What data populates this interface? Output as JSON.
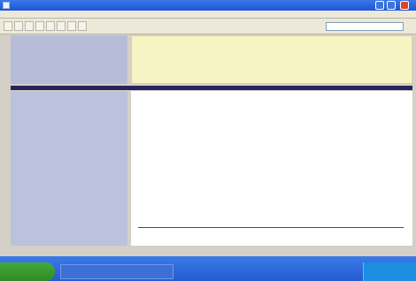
{
  "window": {
    "title": "",
    "caption_buttons": [
      "minimize-icon",
      "maximize-icon",
      "close-icon"
    ]
  },
  "menubar": {
    "items": [
      "",
      "",
      "",
      "",
      "",
      ""
    ]
  },
  "toolbar": {
    "button_icons": [
      "back-icon",
      "forward-icon",
      "stop-icon",
      "refresh-icon",
      "home-icon",
      "search-icon",
      "favorites-icon",
      "history-icon"
    ],
    "address_value": ""
  },
  "nav_sidebar": {
    "links": [
      "",
      "",
      "",
      "",
      "",
      "",
      ""
    ]
  },
  "notice": {
    "lines": [
      "",
      "",
      ""
    ]
  },
  "left_panel": {
    "links": [
      "",
      "",
      "",
      "",
      "",
      "",
      "",
      "",
      "",
      "",
      "",
      "",
      "",
      "",
      "",
      "",
      "",
      "",
      "",
      "",
      "",
      ""
    ]
  },
  "content": {
    "title": "",
    "lines": [
      "",
      "",
      "",
      "",
      "",
      "",
      "",
      "",
      "",
      "",
      "",
      "",
      "",
      "",
      "",
      "",
      ""
    ]
  },
  "taskbar": {
    "start_label": "",
    "window_label": "",
    "clock": ""
  },
  "colors": {
    "titlebar": "#1d54d6",
    "sidebar": "#b7bdd9",
    "notice_background": "#f7f4c4",
    "frame_divider": "#27245e",
    "taskbar": "#245bd2",
    "start_button": "#2f8a24",
    "link": "#17257a"
  }
}
